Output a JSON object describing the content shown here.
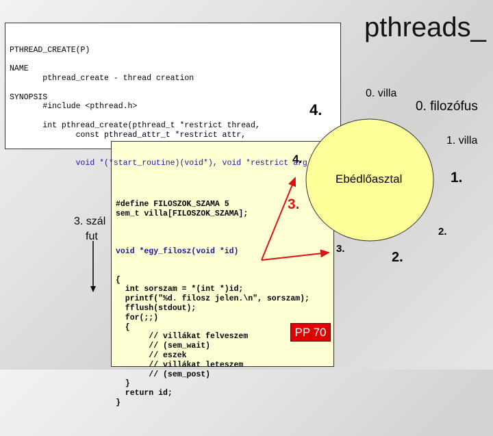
{
  "title": "pthreads_",
  "man": {
    "lines": [
      "PTHREAD_CREATE(P)",
      "",
      "NAME",
      "       pthread_create - thread creation",
      "",
      "SYNOPSIS",
      "       #include <pthread.h>",
      "",
      "       int pthread_create(pthread_t *restrict thread,",
      "              const pthread_attr_t *restrict attr,"
    ],
    "last_line": "              void *(*start_routine)(void*), void *restrict arg"
  },
  "code": {
    "lines_a": [
      "#define FILOSZOK_SZAMA 5",
      "sem_t villa[FILOSZOK_SZAMA];",
      ""
    ],
    "func": "void *egy_filosz(void *id)",
    "lines_b": [
      "{",
      "  int sorszam = *(int *)id;",
      "  printf(\"%d. filosz jelen.\\n\", sorszam);",
      "  fflush(stdout);",
      "  for(;;)",
      "  {",
      "       // villákat felveszem",
      "       // (sem_wait)",
      "       // eszek",
      "       // villákat leteszem",
      "       // (sem_post)",
      "  }",
      "  return id;",
      "}"
    ]
  },
  "labels": {
    "four_a": "4.",
    "four_b": "4.",
    "three_red": "3.",
    "three_black": "3.",
    "thread_line1": "3. szál",
    "thread_line2": "fut",
    "table": "Ebédlőasztal",
    "villa0": "0. villa",
    "filozofus0": "0. filozófus",
    "villa1": "1. villa",
    "one": "1.",
    "two_a": "2.",
    "two_b": "2."
  },
  "badge": "PP 70",
  "colors": {
    "table": "#ffff99",
    "code_bg": "#ffffd4",
    "arrow": "#dd1111",
    "badge": "#e00000"
  }
}
